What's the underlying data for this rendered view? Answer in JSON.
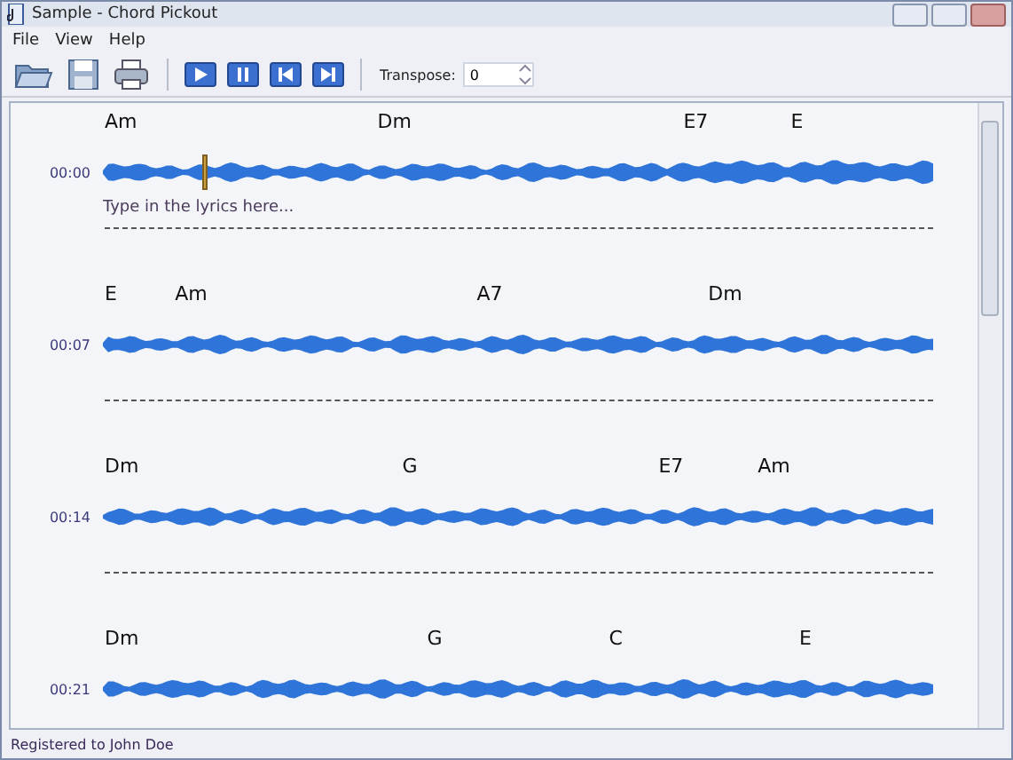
{
  "window": {
    "title": "Sample - Chord Pickout"
  },
  "menu": [
    "File",
    "View",
    "Help"
  ],
  "toolbar": {
    "transpose_label": "Transpose:",
    "transpose_value": "0"
  },
  "rows": [
    {
      "time": "00:00",
      "chords": [
        "Am",
        "Dm",
        "E7",
        "E"
      ],
      "lyrics_placeholder": "Type in the lyrics here...",
      "playhead": true
    },
    {
      "time": "00:07",
      "chords": [
        "E",
        "Am",
        "A7",
        "Dm"
      ],
      "playhead": false
    },
    {
      "time": "00:14",
      "chords": [
        "Dm",
        "G",
        "E7",
        "Am"
      ],
      "playhead": false
    },
    {
      "time": "00:21",
      "chords": [
        "Dm",
        "G",
        "C",
        "E"
      ],
      "playhead": false
    }
  ],
  "status_bar": "Registered to John Doe"
}
